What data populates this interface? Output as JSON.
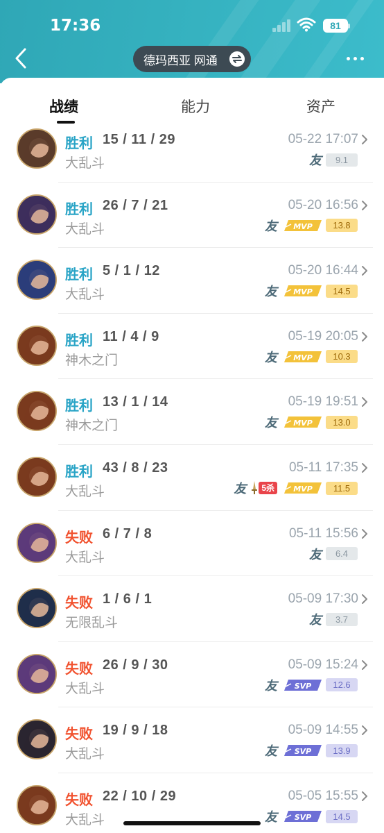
{
  "status_bar": {
    "time": "17:36",
    "battery": "81"
  },
  "header": {
    "server": "德玛西亚 网通"
  },
  "tabs": [
    {
      "label": "战绩",
      "active": true
    },
    {
      "label": "能力",
      "active": false
    },
    {
      "label": "资产",
      "active": false
    }
  ],
  "matches": [
    {
      "result": "胜利",
      "win": true,
      "kda": "15 / 11 / 29",
      "mode": "大乱斗",
      "datetime": "05-22 17:07",
      "badge": "none",
      "score": "9.1",
      "avatar_color": "#5a3b2a"
    },
    {
      "result": "胜利",
      "win": true,
      "kda": "26 / 7 / 21",
      "mode": "大乱斗",
      "datetime": "05-20 16:56",
      "badge": "MVP",
      "score": "13.8",
      "avatar_color": "#3d2e5c"
    },
    {
      "result": "胜利",
      "win": true,
      "kda": "5 / 1 / 12",
      "mode": "大乱斗",
      "datetime": "05-20 16:44",
      "badge": "MVP",
      "score": "14.5",
      "avatar_color": "#2b3d7a"
    },
    {
      "result": "胜利",
      "win": true,
      "kda": "11 / 4 / 9",
      "mode": "神木之门",
      "datetime": "05-19 20:05",
      "badge": "MVP",
      "score": "10.3",
      "avatar_color": "#7a3a1e"
    },
    {
      "result": "胜利",
      "win": true,
      "kda": "13 / 1 / 14",
      "mode": "神木之门",
      "datetime": "05-19 19:51",
      "badge": "MVP",
      "score": "13.0",
      "avatar_color": "#7a3a1e"
    },
    {
      "result": "胜利",
      "win": true,
      "kda": "43 / 8 / 23",
      "mode": "大乱斗",
      "datetime": "05-11 17:35",
      "badge": "MVP",
      "penta": "5杀",
      "score": "11.5",
      "avatar_color": "#7a3a1e"
    },
    {
      "result": "失败",
      "win": false,
      "kda": "6 / 7 / 8",
      "mode": "大乱斗",
      "datetime": "05-11 15:56",
      "badge": "none",
      "score": "6.4",
      "avatar_color": "#5c3a7a"
    },
    {
      "result": "失败",
      "win": false,
      "kda": "1 / 6 / 1",
      "mode": "无限乱斗",
      "datetime": "05-09 17:30",
      "badge": "none",
      "score": "3.7",
      "avatar_color": "#1f2e4a"
    },
    {
      "result": "失败",
      "win": false,
      "kda": "26 / 9 / 30",
      "mode": "大乱斗",
      "datetime": "05-09 15:24",
      "badge": "SVP",
      "score": "12.6",
      "avatar_color": "#5c3a7a"
    },
    {
      "result": "失败",
      "win": false,
      "kda": "19 / 9 / 18",
      "mode": "大乱斗",
      "datetime": "05-09 14:55",
      "badge": "SVP",
      "score": "13.9",
      "avatar_color": "#2a2530"
    },
    {
      "result": "失败",
      "win": false,
      "kda": "22 / 10 / 29",
      "mode": "大乱斗",
      "datetime": "05-05 15:55",
      "badge": "SVP",
      "score": "14.5",
      "avatar_color": "#7a3a1e"
    }
  ],
  "labels": {
    "friend": "友"
  },
  "icons": {
    "back": "chevron-left-icon",
    "swap": "swap-icon",
    "more": "more-icon",
    "row_arrow": "chevron-right-icon"
  },
  "colors": {
    "header": "#35b1bf",
    "win": "#29a4c6",
    "lose": "#f1522f"
  }
}
